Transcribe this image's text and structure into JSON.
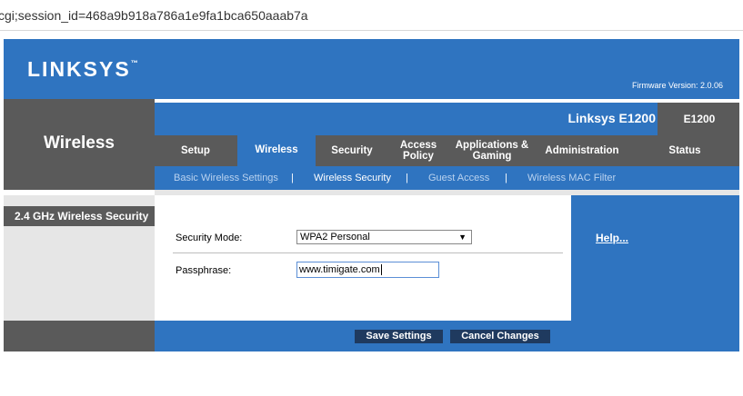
{
  "browser": {
    "url": "cgi;session_id=468a9b918a786a1e9fa1bca650aaab7a"
  },
  "header": {
    "logo": "LINKSYS",
    "logo_mark": "™",
    "firmware": "Firmware Version: 2.0.06"
  },
  "section_title": "Wireless",
  "model": {
    "name": "Linksys E1200",
    "short": "E1200"
  },
  "nav": [
    {
      "label": "Setup"
    },
    {
      "label": "Wireless"
    },
    {
      "label": "Security"
    },
    {
      "label": "Access\nPolicy"
    },
    {
      "label": "Applications &\nGaming"
    },
    {
      "label": "Administration"
    },
    {
      "label": "Status"
    }
  ],
  "subnav": {
    "items": [
      "Basic Wireless Settings",
      "Wireless Security",
      "Guest Access",
      "Wireless MAC Filter"
    ],
    "separator": "|"
  },
  "panel": {
    "title": "2.4 GHz Wireless Security",
    "security_mode_label": "Security Mode:",
    "security_mode_value": "WPA2 Personal",
    "passphrase_label": "Passphrase:",
    "passphrase_value": "www.timigate.com"
  },
  "help": {
    "label": "Help..."
  },
  "buttons": {
    "save": "Save Settings",
    "cancel": "Cancel Changes"
  },
  "colors": {
    "brand_blue": "#2f74c0",
    "dark_gray": "#5a5a5a",
    "button_navy": "#1f3a5f"
  }
}
